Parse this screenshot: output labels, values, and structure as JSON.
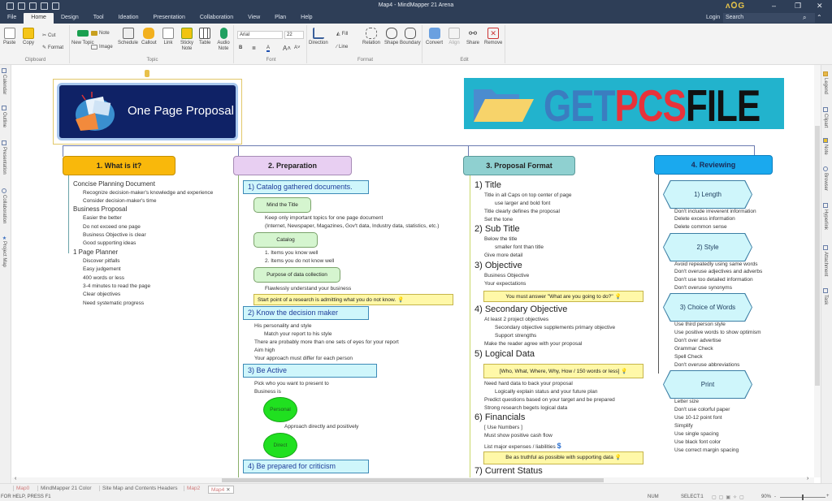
{
  "window": {
    "title": "Map4 - MindMapper 21 Arena",
    "controls": {
      "minimize": "–",
      "restore": "❐",
      "close": "✕"
    },
    "logo": "ᴧՕG"
  },
  "menu": [
    "File",
    "Home",
    "Design",
    "Tool",
    "Ideation",
    "Presentation",
    "Collaboration",
    "View",
    "Plan",
    "Help"
  ],
  "account": {
    "login": "Login",
    "search_placeholder": "Search"
  },
  "ribbon": {
    "clipboard": {
      "label": "Clipboard",
      "paste": "Paste",
      "copy": "Copy",
      "cut": "Cut",
      "format": "Format"
    },
    "topic": {
      "label": "Topic",
      "new_topic": "New Topic",
      "note": "Note",
      "image": "Image",
      "schedule": "Schedule",
      "callout": "Callout",
      "link": "Link",
      "sticky_note": "Sticky Note",
      "table": "Table",
      "audio_note": "Audio Note"
    },
    "font": {
      "label": "Font",
      "family": "Arial",
      "size": "22"
    },
    "format": {
      "label": "Format",
      "direction": "Direction",
      "fill": "Fill",
      "line": "Line",
      "relation": "Relation",
      "shape": "Shape",
      "boundary": "Boundary"
    },
    "edit": {
      "label": "Edit",
      "convert": "Convert",
      "align": "Align",
      "share": "Share",
      "remove": "Remove"
    }
  },
  "left_panel": [
    "Calendar",
    "Outline",
    "Presentation",
    "Collaboration",
    "Project Map"
  ],
  "right_panel": [
    "Legend",
    "Clipart",
    "Note",
    "Browser",
    "Hyperlink",
    "Attachment",
    "Task"
  ],
  "map": {
    "central": "One Page Proposal",
    "banner": {
      "part1": "GET",
      "part2": "PCS",
      "part3": "FILE"
    },
    "col1": {
      "header": "1. What is it?",
      "color": "#f9b80b",
      "groups": [
        {
          "title": "Concise Planning Document",
          "items": [
            "Recognize decision-maker's knowledge and experience",
            "Consider decision-maker's time"
          ]
        },
        {
          "title": "Business Proposal",
          "items": [
            "Easier the better",
            "Do not exceed one page",
            "Business Objective is clear",
            "Good supporting ideas"
          ]
        },
        {
          "title": "1 Page Planner",
          "items": [
            "Discover pitfalls",
            "Easy judgement",
            "400 words or less",
            "3-4 minutes to read the page",
            "Clear objectives",
            "Need systematic progress"
          ]
        }
      ]
    },
    "col2": {
      "header": "2. Preparation",
      "color": "#e8cff2",
      "s1": {
        "title": "1) Catalog gathered documents.",
        "mind_title": "Mind the Title",
        "mind_items": [
          "Keep only important topics for one page document",
          "(Internet, Newspaper, Magazines, Gov't data, Industry data, statistics, etc.)"
        ],
        "catalog": "Catalog",
        "catalog_items": [
          "1. Items you know well",
          "2. Items you do not know well"
        ],
        "purpose": "Purpose of data collection",
        "purpose_items": [
          "Flawlessly understand your business"
        ],
        "note": "Start point of a research is admitting what you do not know."
      },
      "s2": {
        "title": "2)  Know the decision maker",
        "items": [
          "His personality and style",
          "Match your report to his style",
          "There are probably more than one sets of eyes for your report",
          "Aim high",
          "Your approach must differ for each person"
        ]
      },
      "s3": {
        "title": "3) Be Active",
        "items": [
          "Pick who you want to present to",
          "Business is"
        ],
        "personal": "Personal",
        "personal_item": "Approach directly and positively",
        "direct": "Direct"
      },
      "s4": {
        "title": "4) Be prepared for criticism"
      }
    },
    "col3": {
      "header": "3. Proposal Format",
      "color": "#8fd0d0",
      "sections": [
        {
          "title": "1) Title",
          "items": [
            "Title in all Caps on top center of page",
            "use larger and bold font",
            "Title clearly defines the proposal",
            "Set the tone"
          ]
        },
        {
          "title": "2) Sub Title",
          "items": [
            "Below the title",
            "smaller font than title",
            "Give more detail"
          ]
        },
        {
          "title": "3) Objective",
          "items": [
            "Business Objective",
            "Your expectations"
          ],
          "note": "You must answer \"What are you going to do?\""
        },
        {
          "title": "4) Secondary Objective",
          "items": [
            "At least 2 project objectives",
            "Secondary objective supplements primary objective",
            "Support strengths",
            "Make the reader agree with your proposal"
          ]
        },
        {
          "title": "5) Logical Data",
          "note": "[Who, What, Where, Why, How / 150 words or less]",
          "items": [
            "Need hard data to back your proposal",
            "Logically explain status and your future plan",
            "Predict questions based on your target and be prepared",
            "Strong research begets logical data"
          ]
        },
        {
          "title": "6) Financials",
          "items": [
            "[ Use Numbers ]",
            "Must show positive cash flow",
            "List major expenses / liabilities"
          ],
          "note": "Be as truthful as possible with supporting data"
        },
        {
          "title": "7) Current Status"
        }
      ]
    },
    "col4": {
      "header": "4. Reviewing",
      "color": "#1aa9ee",
      "sections": [
        {
          "title": "1) Length",
          "items": [
            "Don't include irreverent information",
            "Delete excess information",
            "Delete common sense"
          ]
        },
        {
          "title": "2) Style",
          "items": [
            "Avoid repeatedly using same words",
            "Don't overuse adjectives and adverbs",
            "Don't use too detailed information",
            "Don't overuse synonyms"
          ]
        },
        {
          "title": "3) Choice of Words",
          "items": [
            "Use third person style",
            "Use positive words to show optimism",
            "Don't over advertise",
            "Grammar Check",
            "Spell Check",
            "Don't overuse abbreviations"
          ]
        },
        {
          "title": "Print",
          "items": [
            "Letter size",
            "Don't use colorful paper",
            "Use 10-12 point font",
            "Simplify",
            "Use single spacing",
            "Use black font color",
            "Use correct margin spacing"
          ]
        }
      ]
    }
  },
  "doc_tabs": [
    {
      "label": "Map0",
      "style": "red"
    },
    {
      "label": "MindMapper 21 Color",
      "style": ""
    },
    {
      "label": "Site Map and Contents Headers",
      "style": ""
    },
    {
      "label": "Map2",
      "style": "red"
    },
    {
      "label": "Map4",
      "style": "active"
    }
  ],
  "status": {
    "help": "FOR HELP, PRESS F1",
    "num": "NUM",
    "select": "SELECT:1",
    "zoom": "90%",
    "zoom_fraction": 0.5
  }
}
